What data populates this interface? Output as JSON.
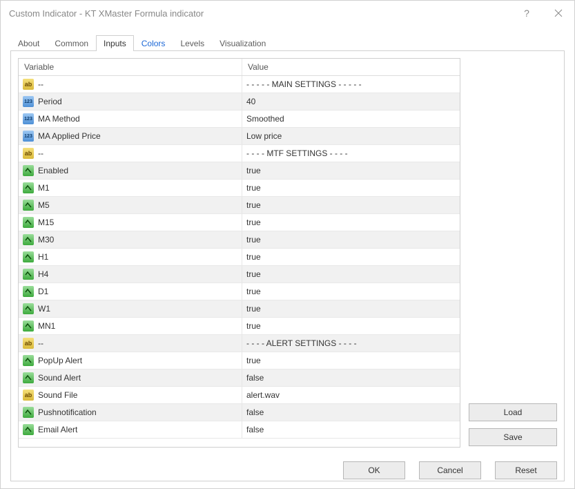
{
  "window": {
    "title": "Custom Indicator - KT XMaster Formula indicator"
  },
  "tabs": {
    "about": "About",
    "common": "Common",
    "inputs": "Inputs",
    "colors": "Colors",
    "levels": "Levels",
    "visualization": "Visualization",
    "active": "inputs"
  },
  "table": {
    "headers": {
      "variable": "Variable",
      "value": "Value"
    },
    "rows": [
      {
        "icon": "ab",
        "name": "--",
        "value": "- - - - - MAIN SETTINGS - - - - -"
      },
      {
        "icon": "123",
        "name": "Period",
        "value": "40"
      },
      {
        "icon": "123",
        "name": "MA Method",
        "value": "Smoothed"
      },
      {
        "icon": "123",
        "name": "MA Applied Price",
        "value": "Low price"
      },
      {
        "icon": "ab",
        "name": "--",
        "value": "- - - - MTF SETTINGS - - - -"
      },
      {
        "icon": "bool",
        "name": "Enabled",
        "value": "true"
      },
      {
        "icon": "bool",
        "name": "M1",
        "value": "true"
      },
      {
        "icon": "bool",
        "name": "M5",
        "value": "true"
      },
      {
        "icon": "bool",
        "name": "M15",
        "value": "true"
      },
      {
        "icon": "bool",
        "name": "M30",
        "value": "true"
      },
      {
        "icon": "bool",
        "name": "H1",
        "value": "true"
      },
      {
        "icon": "bool",
        "name": "H4",
        "value": "true"
      },
      {
        "icon": "bool",
        "name": "D1",
        "value": "true"
      },
      {
        "icon": "bool",
        "name": "W1",
        "value": "true"
      },
      {
        "icon": "bool",
        "name": "MN1",
        "value": "true"
      },
      {
        "icon": "ab",
        "name": "--",
        "value": "- - - - ALERT SETTINGS - - - -"
      },
      {
        "icon": "bool",
        "name": "PopUp Alert",
        "value": "true"
      },
      {
        "icon": "bool",
        "name": "Sound Alert",
        "value": "false"
      },
      {
        "icon": "ab",
        "name": "Sound File",
        "value": "alert.wav"
      },
      {
        "icon": "bool",
        "name": "Pushnotification",
        "value": "false"
      },
      {
        "icon": "bool",
        "name": "Email Alert",
        "value": "false"
      }
    ]
  },
  "buttons": {
    "load": "Load",
    "save": "Save",
    "ok": "OK",
    "cancel": "Cancel",
    "reset": "Reset"
  }
}
